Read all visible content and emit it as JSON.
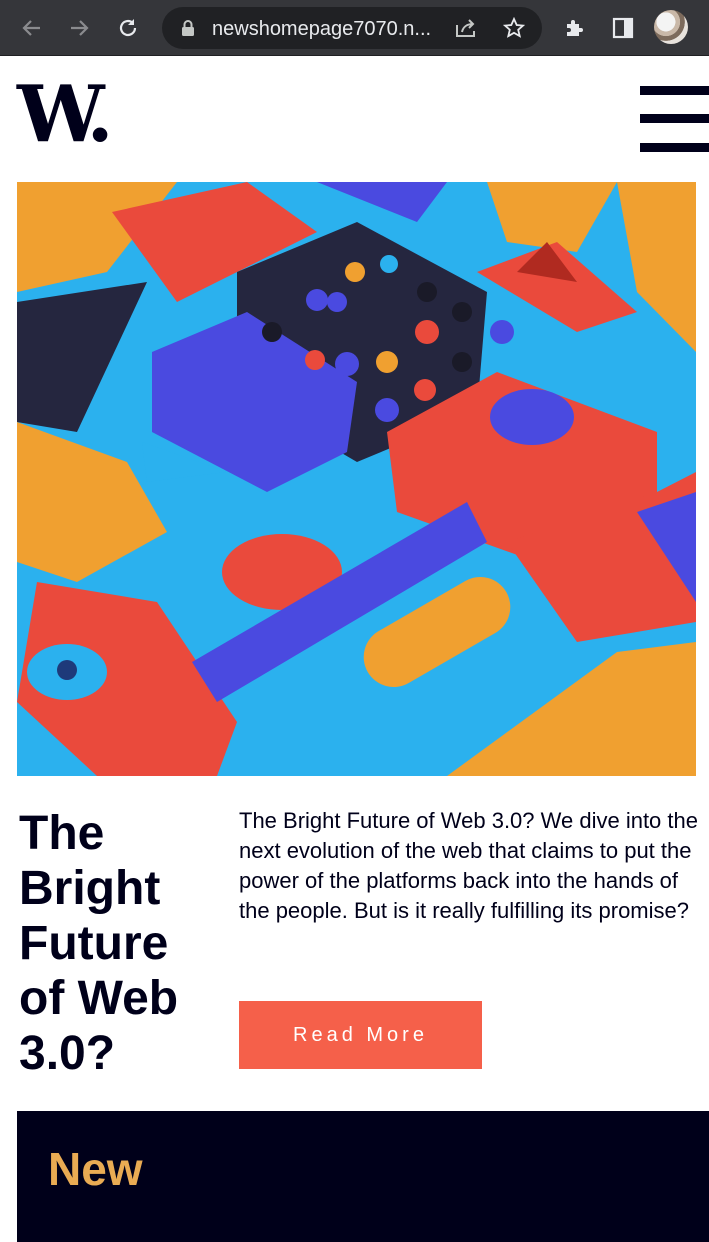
{
  "browser": {
    "url": "newshomepage7070.n...",
    "icons": [
      "back-arrow-icon",
      "forward-arrow-icon",
      "reload-icon",
      "lock-icon",
      "share-icon",
      "star-icon",
      "extensions-icon",
      "side-panel-icon",
      "profile-avatar"
    ]
  },
  "header": {
    "logo_text": "W.",
    "menu_icon": "hamburger-menu-icon"
  },
  "hero": {
    "image_description_icon": "abstract-3d-blocks-image",
    "colors": {
      "orange": "#f0a030",
      "red": "#ea4a3c",
      "blue": "#4a4ae0",
      "cyan": "#2bb1ee",
      "dark": "#25263f"
    }
  },
  "article": {
    "headline": "The Bright Future of Web 3.0?",
    "description": "The Bright Future of Web 3.0? We dive into the next evolution of the web that claims to put the power of the platforms back into the hands of the people. But is it really fulfilling its promise?",
    "button_label": "Read More"
  },
  "new_section": {
    "title": "New"
  },
  "theme": {
    "accent": "#f5604a",
    "dark_navy": "#00001a",
    "gold": "#e9ab53"
  }
}
